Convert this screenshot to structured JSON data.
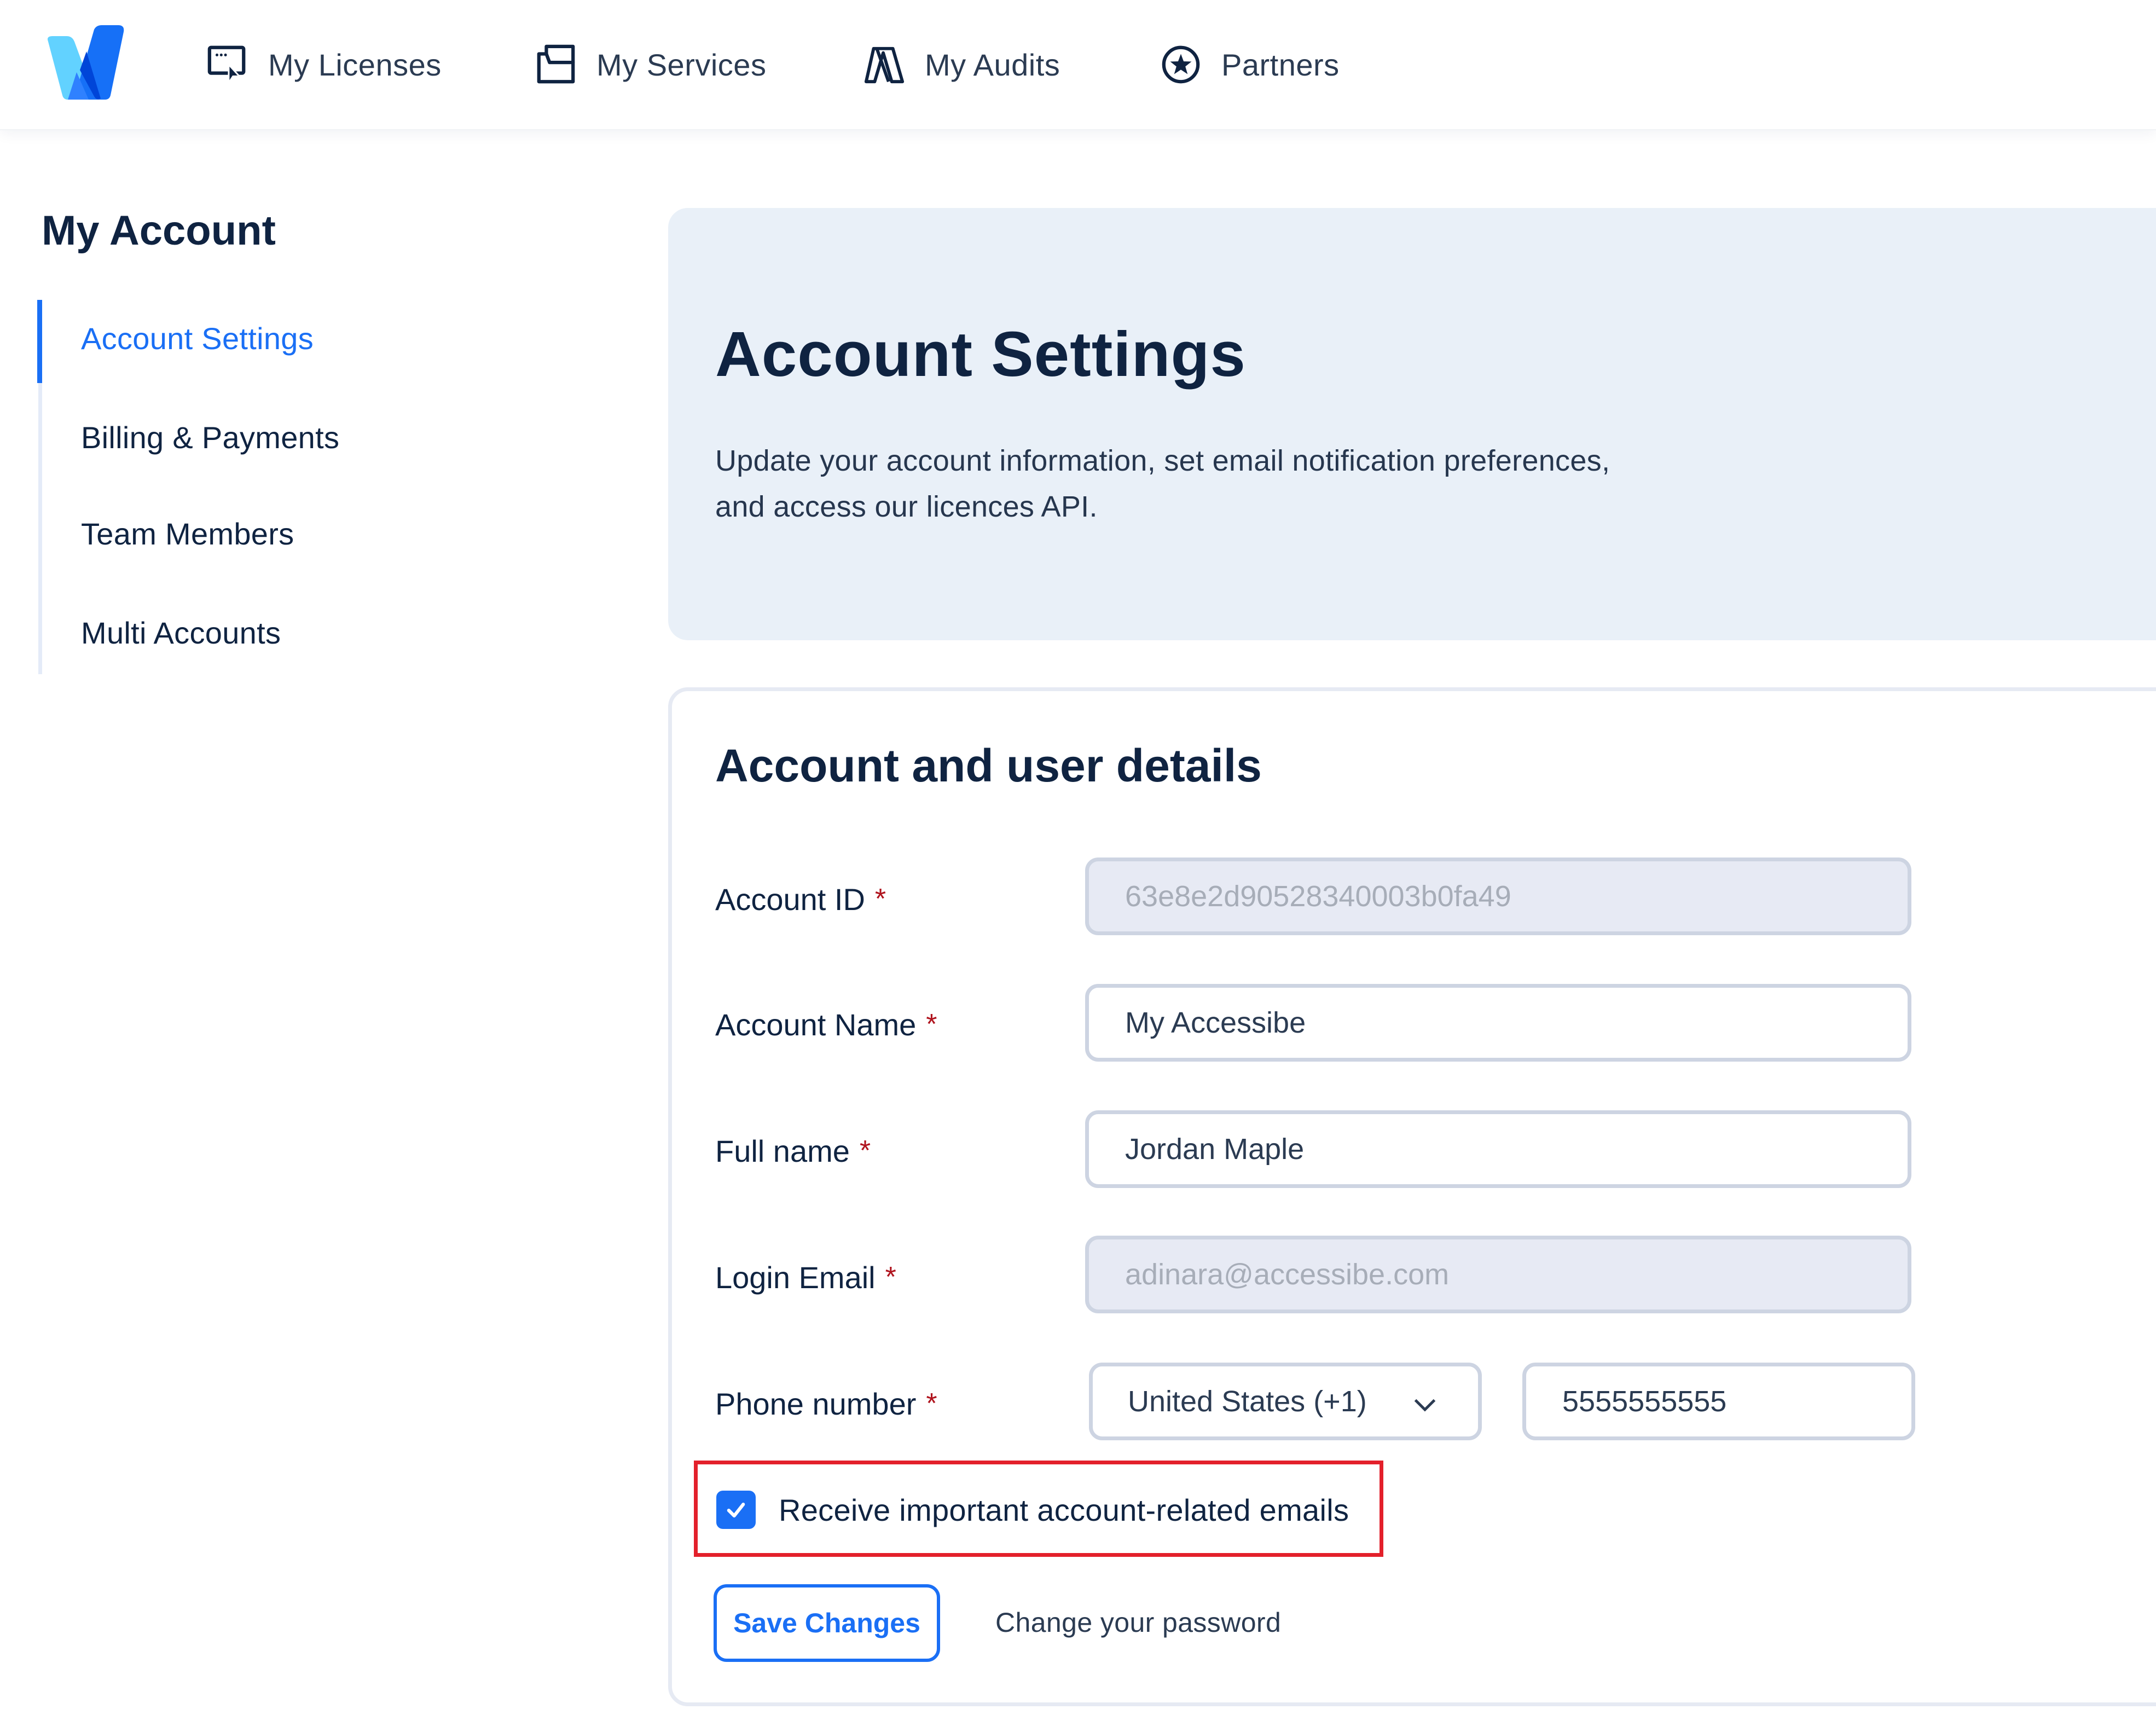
{
  "brand": {
    "logo_icon": "accessibe-checkmark-logo",
    "colors": {
      "primary": "#1a6ff5",
      "logo_light": "#62d2ff",
      "logo_mid": "#2f81ff",
      "logo_dark": "#0045d8",
      "text_dark": "#0f2341",
      "banner_bg": "#e9f0f8",
      "required": "#b0141e",
      "highlight_box": "#e3202b"
    }
  },
  "topnav": {
    "items": [
      {
        "label": "My Licenses",
        "icon": "screen-cursor-icon"
      },
      {
        "label": "My Services",
        "icon": "folder-icon"
      },
      {
        "label": "My Audits",
        "icon": "audit-icon"
      },
      {
        "label": "Partners",
        "icon": "star-circle-icon"
      }
    ]
  },
  "sidebar": {
    "title": "My Account",
    "items": [
      {
        "label": "Account Settings",
        "active": true
      },
      {
        "label": "Billing & Payments",
        "active": false
      },
      {
        "label": "Team Members",
        "active": false
      },
      {
        "label": "Multi Accounts",
        "active": false
      }
    ]
  },
  "banner": {
    "title": "Account Settings",
    "subtitle_line1": "Update your account information, set email notification preferences,",
    "subtitle_line2": "and access our licences API."
  },
  "form": {
    "title": "Account and user details",
    "required_marker": "*",
    "fields": [
      {
        "label": "Account ID",
        "value": "63e8e2d90528340003b0fa49",
        "readonly": true
      },
      {
        "label": "Account Name",
        "value": "My Accessibe",
        "readonly": false
      },
      {
        "label": "Full name",
        "value": "Jordan Maple",
        "readonly": false
      },
      {
        "label": "Login Email",
        "value": "adinara@accessibe.com",
        "readonly": true
      }
    ],
    "phone": {
      "label": "Phone number",
      "country": "United States (+1)",
      "number": "5555555555"
    },
    "consent": {
      "label": "Receive important account-related emails",
      "checked": true
    },
    "save_label": "Save Changes",
    "change_password_label": "Change your password"
  }
}
